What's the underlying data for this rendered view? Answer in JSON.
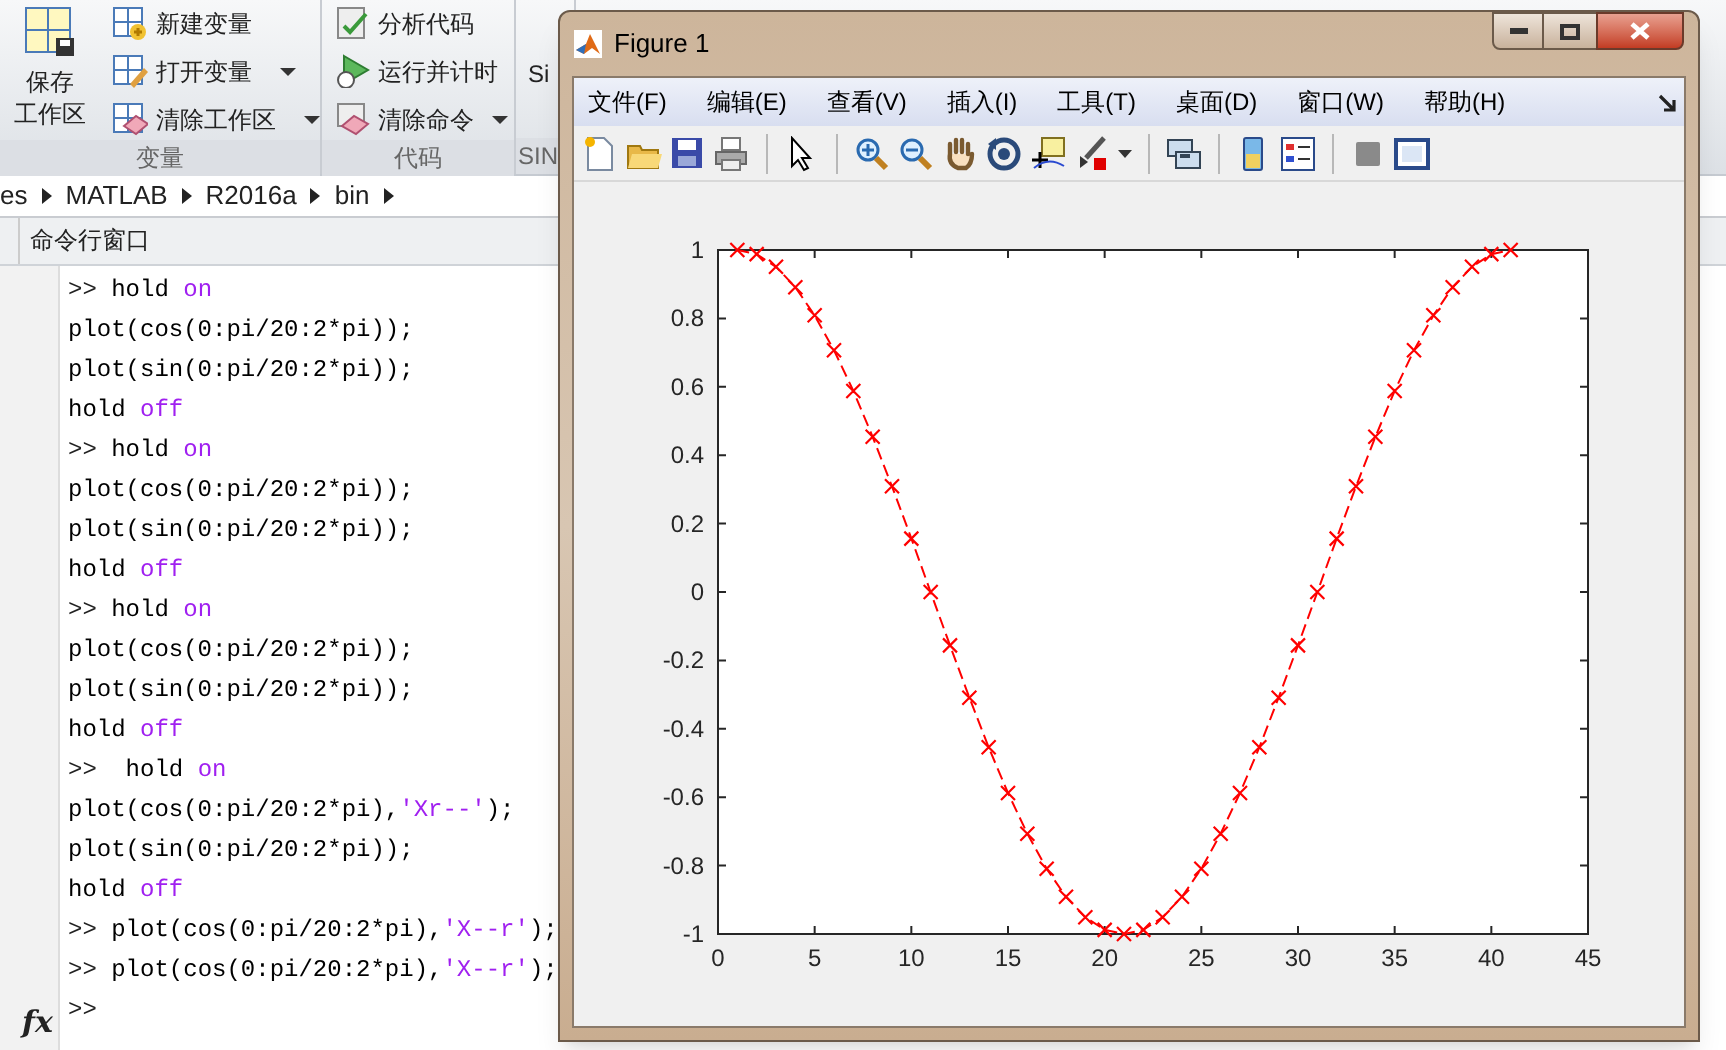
{
  "ribbon": {
    "groups": [
      {
        "label": "变量",
        "big_button": {
          "lines": [
            "保存",
            "工作区"
          ]
        },
        "items": [
          {
            "label": "新建变量",
            "dropdown": false
          },
          {
            "label": "打开变量",
            "dropdown": true
          },
          {
            "label": "清除工作区",
            "dropdown": true
          }
        ]
      },
      {
        "label": "代码",
        "items": [
          {
            "label": "分析代码",
            "dropdown": false
          },
          {
            "label": "运行并计时",
            "dropdown": false
          },
          {
            "label": "清除命令",
            "dropdown": true
          }
        ]
      },
      {
        "label": "SIN",
        "cut_button": "Si"
      }
    ]
  },
  "breadcrumb": [
    "es",
    "MATLAB",
    "R2016a",
    "bin"
  ],
  "command_window": {
    "title": "命令行窗口",
    "function_button": "fx",
    "lines": [
      {
        "prompt": ">>",
        "parts": [
          {
            "kind": "code",
            "text": " hold "
          },
          {
            "kind": "keyword",
            "text": "on"
          }
        ]
      },
      {
        "parts": [
          {
            "kind": "code",
            "text": "plot(cos(0:pi/20:2*pi));"
          }
        ]
      },
      {
        "parts": [
          {
            "kind": "code",
            "text": "plot(sin(0:pi/20:2*pi));"
          }
        ]
      },
      {
        "parts": [
          {
            "kind": "code",
            "text": "hold "
          },
          {
            "kind": "keyword",
            "text": "off"
          }
        ]
      },
      {
        "prompt": ">>",
        "parts": [
          {
            "kind": "code",
            "text": " hold "
          },
          {
            "kind": "keyword",
            "text": "on"
          }
        ]
      },
      {
        "parts": [
          {
            "kind": "code",
            "text": "plot(cos(0:pi/20:2*pi));"
          }
        ]
      },
      {
        "parts": [
          {
            "kind": "code",
            "text": "plot(sin(0:pi/20:2*pi));"
          }
        ]
      },
      {
        "parts": [
          {
            "kind": "code",
            "text": "hold "
          },
          {
            "kind": "keyword",
            "text": "off"
          }
        ]
      },
      {
        "prompt": ">>",
        "parts": [
          {
            "kind": "code",
            "text": " hold "
          },
          {
            "kind": "keyword",
            "text": "on"
          }
        ]
      },
      {
        "parts": [
          {
            "kind": "code",
            "text": "plot(cos(0:pi/20:2*pi));"
          }
        ]
      },
      {
        "parts": [
          {
            "kind": "code",
            "text": "plot(sin(0:pi/20:2*pi));"
          }
        ]
      },
      {
        "parts": [
          {
            "kind": "code",
            "text": "hold "
          },
          {
            "kind": "keyword",
            "text": "off"
          }
        ]
      },
      {
        "prompt": ">>",
        "parts": [
          {
            "kind": "code",
            "text": "  hold "
          },
          {
            "kind": "keyword",
            "text": "on"
          }
        ]
      },
      {
        "parts": [
          {
            "kind": "code",
            "text": "plot(cos(0:pi/20:2*pi),"
          },
          {
            "kind": "string",
            "text": "'Xr--'"
          },
          {
            "kind": "code",
            "text": ");"
          }
        ]
      },
      {
        "parts": [
          {
            "kind": "code",
            "text": "plot(sin(0:pi/20:2*pi));"
          }
        ]
      },
      {
        "parts": [
          {
            "kind": "code",
            "text": "hold "
          },
          {
            "kind": "keyword",
            "text": "off"
          }
        ]
      },
      {
        "prompt": ">>",
        "parts": [
          {
            "kind": "code",
            "text": " plot(cos(0:pi/20:2*pi),"
          },
          {
            "kind": "string",
            "text": "'X--r'"
          },
          {
            "kind": "code",
            "text": ");"
          }
        ]
      },
      {
        "prompt": ">>",
        "parts": [
          {
            "kind": "code",
            "text": " plot(cos(0:pi/20:2*pi),"
          },
          {
            "kind": "string",
            "text": "'X--r'"
          },
          {
            "kind": "code",
            "text": ");"
          }
        ]
      },
      {
        "prompt": ">>"
      }
    ]
  },
  "figure": {
    "title": "Figure 1",
    "menus": [
      "文件(F)",
      "编辑(E)",
      "查看(V)",
      "插入(I)",
      "工具(T)",
      "桌面(D)",
      "窗口(W)",
      "帮助(H)"
    ],
    "chart_data": {
      "type": "line",
      "x": [
        1,
        2,
        3,
        4,
        5,
        6,
        7,
        8,
        9,
        10,
        11,
        12,
        13,
        14,
        15,
        16,
        17,
        18,
        19,
        20,
        21,
        22,
        23,
        24,
        25,
        26,
        27,
        28,
        29,
        30,
        31,
        32,
        33,
        34,
        35,
        36,
        37,
        38,
        39,
        40,
        41
      ],
      "series": [
        {
          "color": "#ff0000",
          "line_style": "--",
          "marker": "x",
          "values": [
            1,
            0.988,
            0.951,
            0.891,
            0.809,
            0.707,
            0.588,
            0.454,
            0.309,
            0.156,
            0,
            -0.156,
            -0.309,
            -0.454,
            -0.588,
            -0.707,
            -0.809,
            -0.891,
            -0.951,
            -0.988,
            -1,
            -0.988,
            -0.951,
            -0.891,
            -0.809,
            -0.707,
            -0.588,
            -0.454,
            -0.309,
            -0.156,
            0,
            0.156,
            0.309,
            0.454,
            0.588,
            0.707,
            0.809,
            0.891,
            0.951,
            0.988,
            1
          ]
        }
      ],
      "xlim": [
        0,
        45
      ],
      "ylim": [
        -1,
        1
      ],
      "xticks": [
        0,
        5,
        10,
        15,
        20,
        25,
        30,
        35,
        40,
        45
      ],
      "yticks": [
        -1,
        -0.8,
        -0.6,
        -0.4,
        -0.2,
        0,
        0.2,
        0.4,
        0.6,
        0.8,
        1
      ]
    }
  }
}
